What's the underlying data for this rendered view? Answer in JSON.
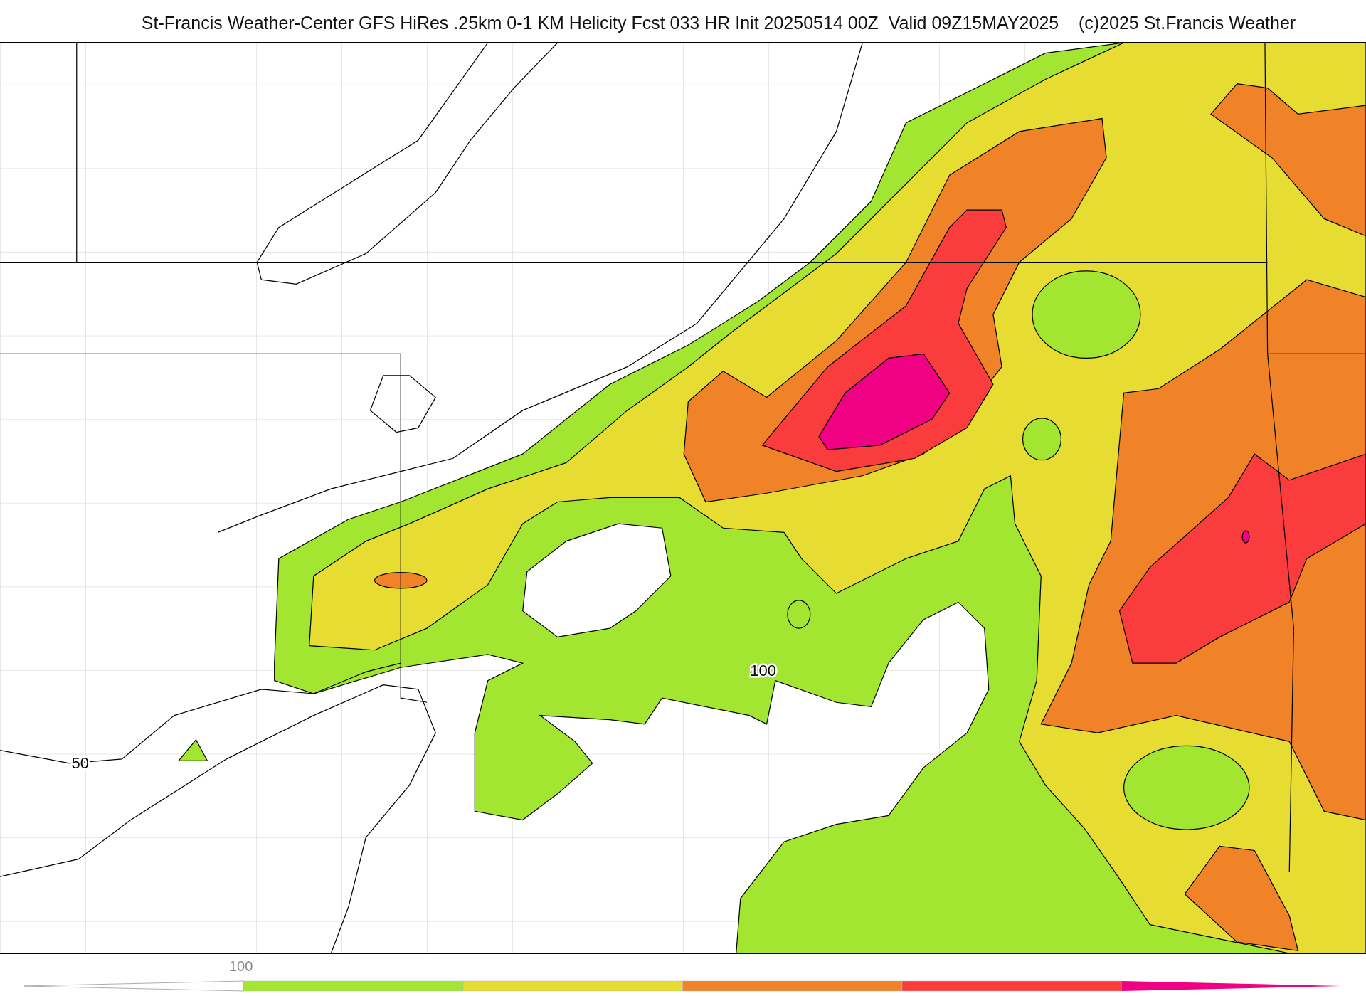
{
  "title": "St-Francis Weather-Center GFS HiRes .25km 0-1 KM Helicity Fcst 033 HR Init 20250514 00Z  Valid 09Z15MAY2025    (c)2025 St.Francis Weather",
  "map": {
    "contour_labels": [
      {
        "text": "100"
      },
      {
        "text": "50"
      }
    ]
  },
  "colorbar": {
    "tick_label": "100",
    "segments": [
      {
        "kind": "triangle-left",
        "color": "#ffffff"
      },
      {
        "kind": "bar",
        "color": "#a3e632"
      },
      {
        "kind": "bar",
        "color": "#e6dc32"
      },
      {
        "kind": "bar",
        "color": "#f08228"
      },
      {
        "kind": "bar",
        "color": "#fa3c3c"
      },
      {
        "kind": "triangle-right",
        "color": "#f00082"
      }
    ]
  }
}
